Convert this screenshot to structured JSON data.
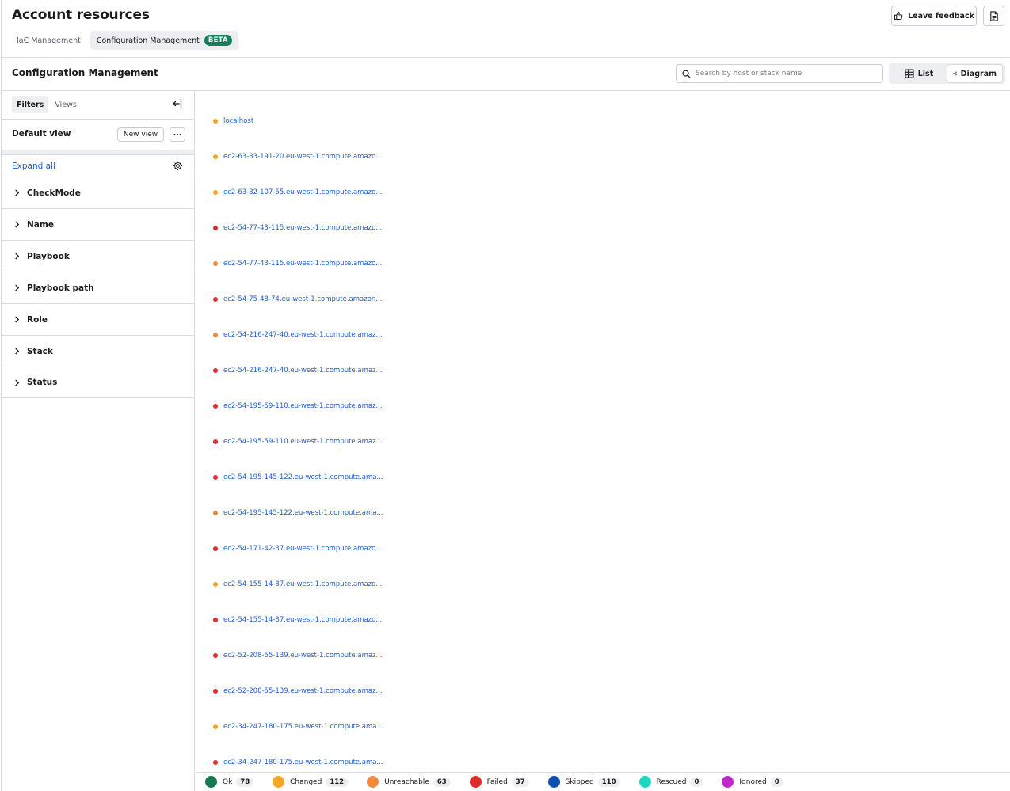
{
  "header": {
    "title": "Account resources",
    "tabs": [
      {
        "label": "IaC Management"
      },
      {
        "label": "Configuration Management",
        "badge": "BETA"
      }
    ],
    "feedback_label": "Leave feedback"
  },
  "subheader": {
    "title": "Configuration Management",
    "search_placeholder": "Search by host or stack name",
    "view_list": "List",
    "view_diagram": "Diagram"
  },
  "sidebar": {
    "tab_filters": "Filters",
    "tab_views": "Views",
    "view_name": "Default view",
    "new_view_label": "New view",
    "expand_all": "Expand all",
    "filters": [
      "CheckMode",
      "Name",
      "Playbook",
      "Playbook path",
      "Role",
      "Stack",
      "Status"
    ]
  },
  "status_colors": {
    "ok": "#137a52",
    "changed": "#f5a623",
    "unreachable": "#f0883e",
    "failed": "#e02c2c",
    "skipped": "#0b4fb3",
    "rescued": "#1fd6c0",
    "ignored": "#c028c9"
  },
  "hosts": [
    {
      "name": "localhost",
      "status": "changed"
    },
    {
      "name": "ec2-63-33-191-20.eu-west-1.compute.amazo...",
      "status": "changed"
    },
    {
      "name": "ec2-63-32-107-55.eu-west-1.compute.amazo...",
      "status": "changed"
    },
    {
      "name": "ec2-54-77-43-115.eu-west-1.compute.amazo...",
      "status": "failed"
    },
    {
      "name": "ec2-54-77-43-115.eu-west-1.compute.amazo...",
      "status": "unreachable"
    },
    {
      "name": "ec2-54-75-48-74.eu-west-1.compute.amazon...",
      "status": "failed"
    },
    {
      "name": "ec2-54-216-247-40.eu-west-1.compute.amaz...",
      "status": "unreachable"
    },
    {
      "name": "ec2-54-216-247-40.eu-west-1.compute.amaz...",
      "status": "failed"
    },
    {
      "name": "ec2-54-195-59-110.eu-west-1.compute.amaz...",
      "status": "failed"
    },
    {
      "name": "ec2-54-195-59-110.eu-west-1.compute.amaz...",
      "status": "failed"
    },
    {
      "name": "ec2-54-195-145-122.eu-west-1.compute.ama...",
      "status": "failed"
    },
    {
      "name": "ec2-54-195-145-122.eu-west-1.compute.ama...",
      "status": "unreachable"
    },
    {
      "name": "ec2-54-171-42-37.eu-west-1.compute.amazo...",
      "status": "failed"
    },
    {
      "name": "ec2-54-155-14-87.eu-west-1.compute.amazo...",
      "status": "changed"
    },
    {
      "name": "ec2-54-155-14-87.eu-west-1.compute.amazo...",
      "status": "failed"
    },
    {
      "name": "ec2-52-208-55-139.eu-west-1.compute.amaz...",
      "status": "failed"
    },
    {
      "name": "ec2-52-208-55-139.eu-west-1.compute.amaz...",
      "status": "failed"
    },
    {
      "name": "ec2-34-247-180-175.eu-west-1.compute.ama...",
      "status": "changed"
    },
    {
      "name": "ec2-34-247-180-175.eu-west-1.compute.ama...",
      "status": "failed"
    }
  ],
  "legend": [
    {
      "label": "Ok",
      "count": "78",
      "status": "ok"
    },
    {
      "label": "Changed",
      "count": "112",
      "status": "changed"
    },
    {
      "label": "Unreachable",
      "count": "63",
      "status": "unreachable"
    },
    {
      "label": "Failed",
      "count": "37",
      "status": "failed"
    },
    {
      "label": "Skipped",
      "count": "110",
      "status": "skipped"
    },
    {
      "label": "Rescued",
      "count": "0",
      "status": "rescued"
    },
    {
      "label": "Ignored",
      "count": "0",
      "status": "ignored"
    }
  ]
}
